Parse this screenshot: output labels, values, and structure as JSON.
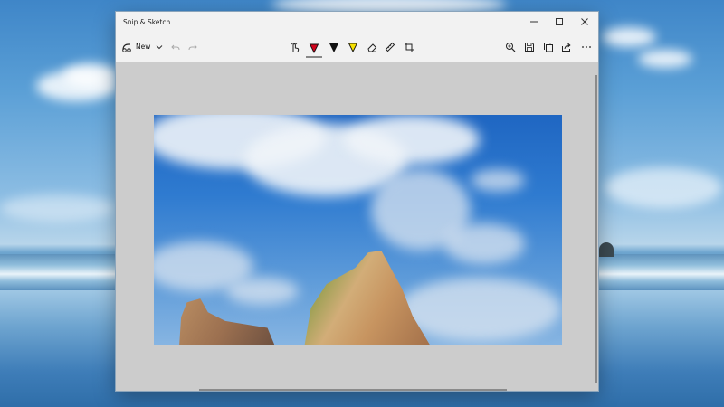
{
  "window": {
    "title": "Snip & Sketch",
    "controls": {
      "minimize_icon": "minimize-icon",
      "maximize_icon": "maximize-icon",
      "close_icon": "close-icon"
    }
  },
  "toolbar": {
    "new_label": "New",
    "tools": [
      {
        "name": "touch-writing-icon"
      },
      {
        "name": "ballpoint-pen-icon",
        "color": "#d0021b"
      },
      {
        "name": "pencil-icon",
        "color": "#111111"
      },
      {
        "name": "highlighter-icon",
        "color": "#f5e000"
      },
      {
        "name": "eraser-icon"
      },
      {
        "name": "ruler-icon"
      },
      {
        "name": "crop-icon"
      }
    ],
    "right_tools": [
      "zoom-icon",
      "save-icon",
      "copy-icon",
      "share-icon",
      "more-icon"
    ]
  },
  "colors": {
    "accent": "#0078d7",
    "canvas_background": "#cccccc",
    "window_background": "#f2f2f2"
  }
}
